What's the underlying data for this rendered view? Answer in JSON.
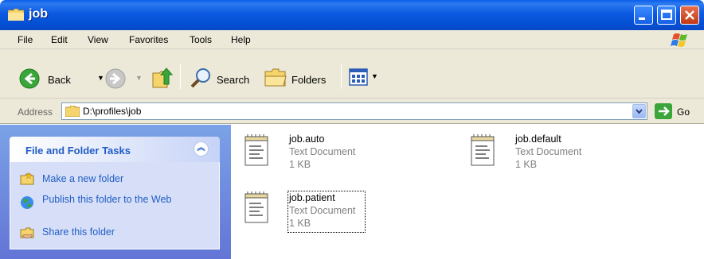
{
  "window": {
    "title": "job"
  },
  "menu": [
    "File",
    "Edit",
    "View",
    "Favorites",
    "Tools",
    "Help"
  ],
  "toolbar": {
    "back": "Back",
    "search": "Search",
    "folders": "Folders"
  },
  "address": {
    "label": "Address",
    "path": "D:\\profiles\\job",
    "go": "Go"
  },
  "tasks": {
    "title": "File and Folder Tasks",
    "items": [
      {
        "label": "Make a new folder"
      },
      {
        "label": "Publish this folder to the Web"
      },
      {
        "label": "Share this folder"
      }
    ]
  },
  "files": [
    {
      "name": "job.auto",
      "type": "Text Document",
      "size": "1 KB"
    },
    {
      "name": "job.default",
      "type": "Text Document",
      "size": "1 KB"
    },
    {
      "name": "job.patient",
      "type": "Text Document",
      "size": "1 KB"
    }
  ],
  "colors": {
    "titlebar": "#0a5ee8",
    "panel": "#7ba2e7",
    "link": "#215dc6",
    "chrome": "#ece9d8"
  }
}
